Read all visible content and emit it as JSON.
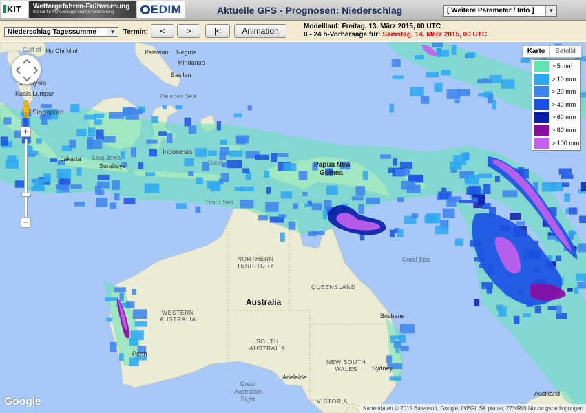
{
  "header": {
    "logo_kit": "KIT",
    "logo_warn_title": "Wettergefahren-Frühwarnung",
    "logo_warn_sub": "Institut für Meteorologie und Klimaforschung",
    "logo_cedim": "EDIM",
    "title": "Aktuelle GFS - Prognosen: Niederschlag",
    "more_params": "[ Weitere Parameter / Info ]"
  },
  "toolbar": {
    "parameter": "Niederschlag Tagessumme",
    "termin_label": "Termin:",
    "prev": "<",
    "next": ">",
    "first": "|<",
    "animation": "Animation",
    "run_label": "Modelllauf: Freitag, 13. März 2015, 00 UTC",
    "forecast_prefix": "0 - 24 h-Vorhersage für:",
    "forecast_date": "Samstag, 14. März 2015, 00 UTC"
  },
  "maptype": {
    "karte": "Karte",
    "satellit": "Satellit"
  },
  "legend": {
    "items": [
      {
        "label": "> 5 mm",
        "color": "#64e4b0"
      },
      {
        "label": "> 10 mm",
        "color": "#2ea8f2"
      },
      {
        "label": "> 20 mm",
        "color": "#3c84ee"
      },
      {
        "label": "> 40 mm",
        "color": "#1c52e4"
      },
      {
        "label": "> 60 mm",
        "color": "#0a1ea8"
      },
      {
        "label": "> 80 mm",
        "color": "#8a0ca2"
      },
      {
        "label": "> 100 mm",
        "color": "#c460ee"
      }
    ]
  },
  "map_labels": {
    "gulf": "Gulf of",
    "hcm": "Ho Chi Minh",
    "palawan": "Palawan",
    "negros": "Negros",
    "mindanao": "Mindanao",
    "basilan": "Basilan",
    "malaysia": "Malaysia",
    "kuala": "Kuala Lumpur",
    "singapore": "Singapore",
    "celebes": "Celebes Sea",
    "laut_jawa": "Laut Jawa",
    "jakarta": "Jakarta",
    "surabaya": "Surabaya",
    "indonesia": "Indonesia",
    "sund": "Sund",
    "papua1": "Papua New",
    "papua2": "Guinea",
    "timor": "Timor Sea",
    "coral": "Coral Sea",
    "australia": "Australia",
    "nt": "NORTHERN\nTERRITORY",
    "qld": "QUEENSLAND",
    "wa": "WESTERN\nAUSTRALIA",
    "sa": "SOUTH\nAUSTRALIA",
    "nsw": "NEW SOUTH\nWALES",
    "vic": "VICTORIA",
    "brisbane": "Brisbane",
    "perth": "Perth",
    "adelaide": "Adelaide",
    "sydney": "Sydney",
    "great1": "Great",
    "great2": "Australian",
    "great3": "Bight",
    "auckland": "Auckland"
  },
  "footer": {
    "google": "Google",
    "attribution": "Kartendaten © 2015 Basarsoft, Google, INEGI, SK planet, ZENRIN   Nutzungsbedingungen"
  }
}
